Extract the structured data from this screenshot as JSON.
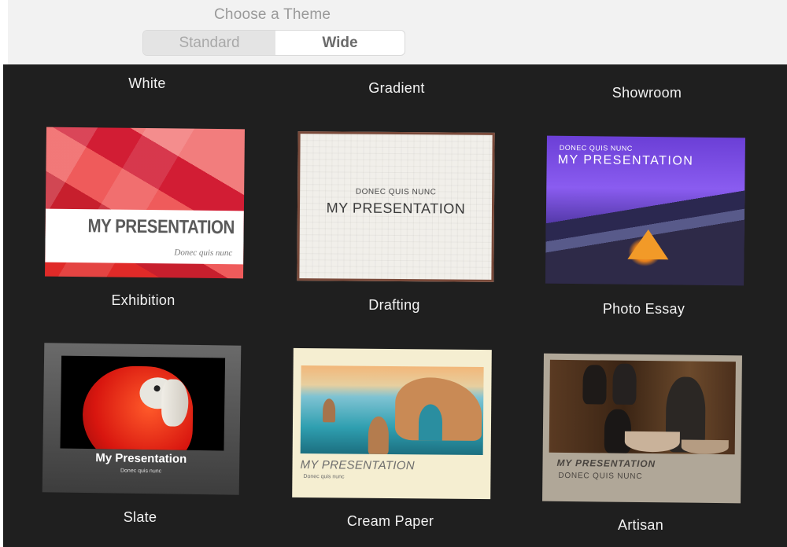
{
  "header": {
    "title": "Choose a Theme",
    "segments": [
      "Standard",
      "Wide"
    ],
    "selected_segment": "Standard"
  },
  "top_labels": [
    "White",
    "Gradient",
    "Showroom"
  ],
  "themes": [
    {
      "label": "Exhibition",
      "preview_title": "MY PRESENTATION",
      "preview_subtitle": "Donec quis nunc"
    },
    {
      "label": "Drafting",
      "preview_title": "MY PRESENTATION",
      "preview_subtitle": "DONEC QUIS NUNC"
    },
    {
      "label": "Photo Essay",
      "preview_title": "MY PRESENTATION",
      "preview_subtitle": "DONEC QUIS NUNC"
    },
    {
      "label": "Slate",
      "preview_title": "My Presentation",
      "preview_subtitle": "Donec quis nunc"
    },
    {
      "label": "Cream Paper",
      "preview_title": "MY PRESENTATION",
      "preview_subtitle": "Donec quis nunc"
    },
    {
      "label": "Artisan",
      "preview_title": "MY PRESENTATION",
      "preview_subtitle": "DONEC QUIS NUNC"
    }
  ],
  "colors": {
    "background": "#1f1f1f",
    "header": "#f2f2f2",
    "label_text": "#f2f2f2"
  }
}
